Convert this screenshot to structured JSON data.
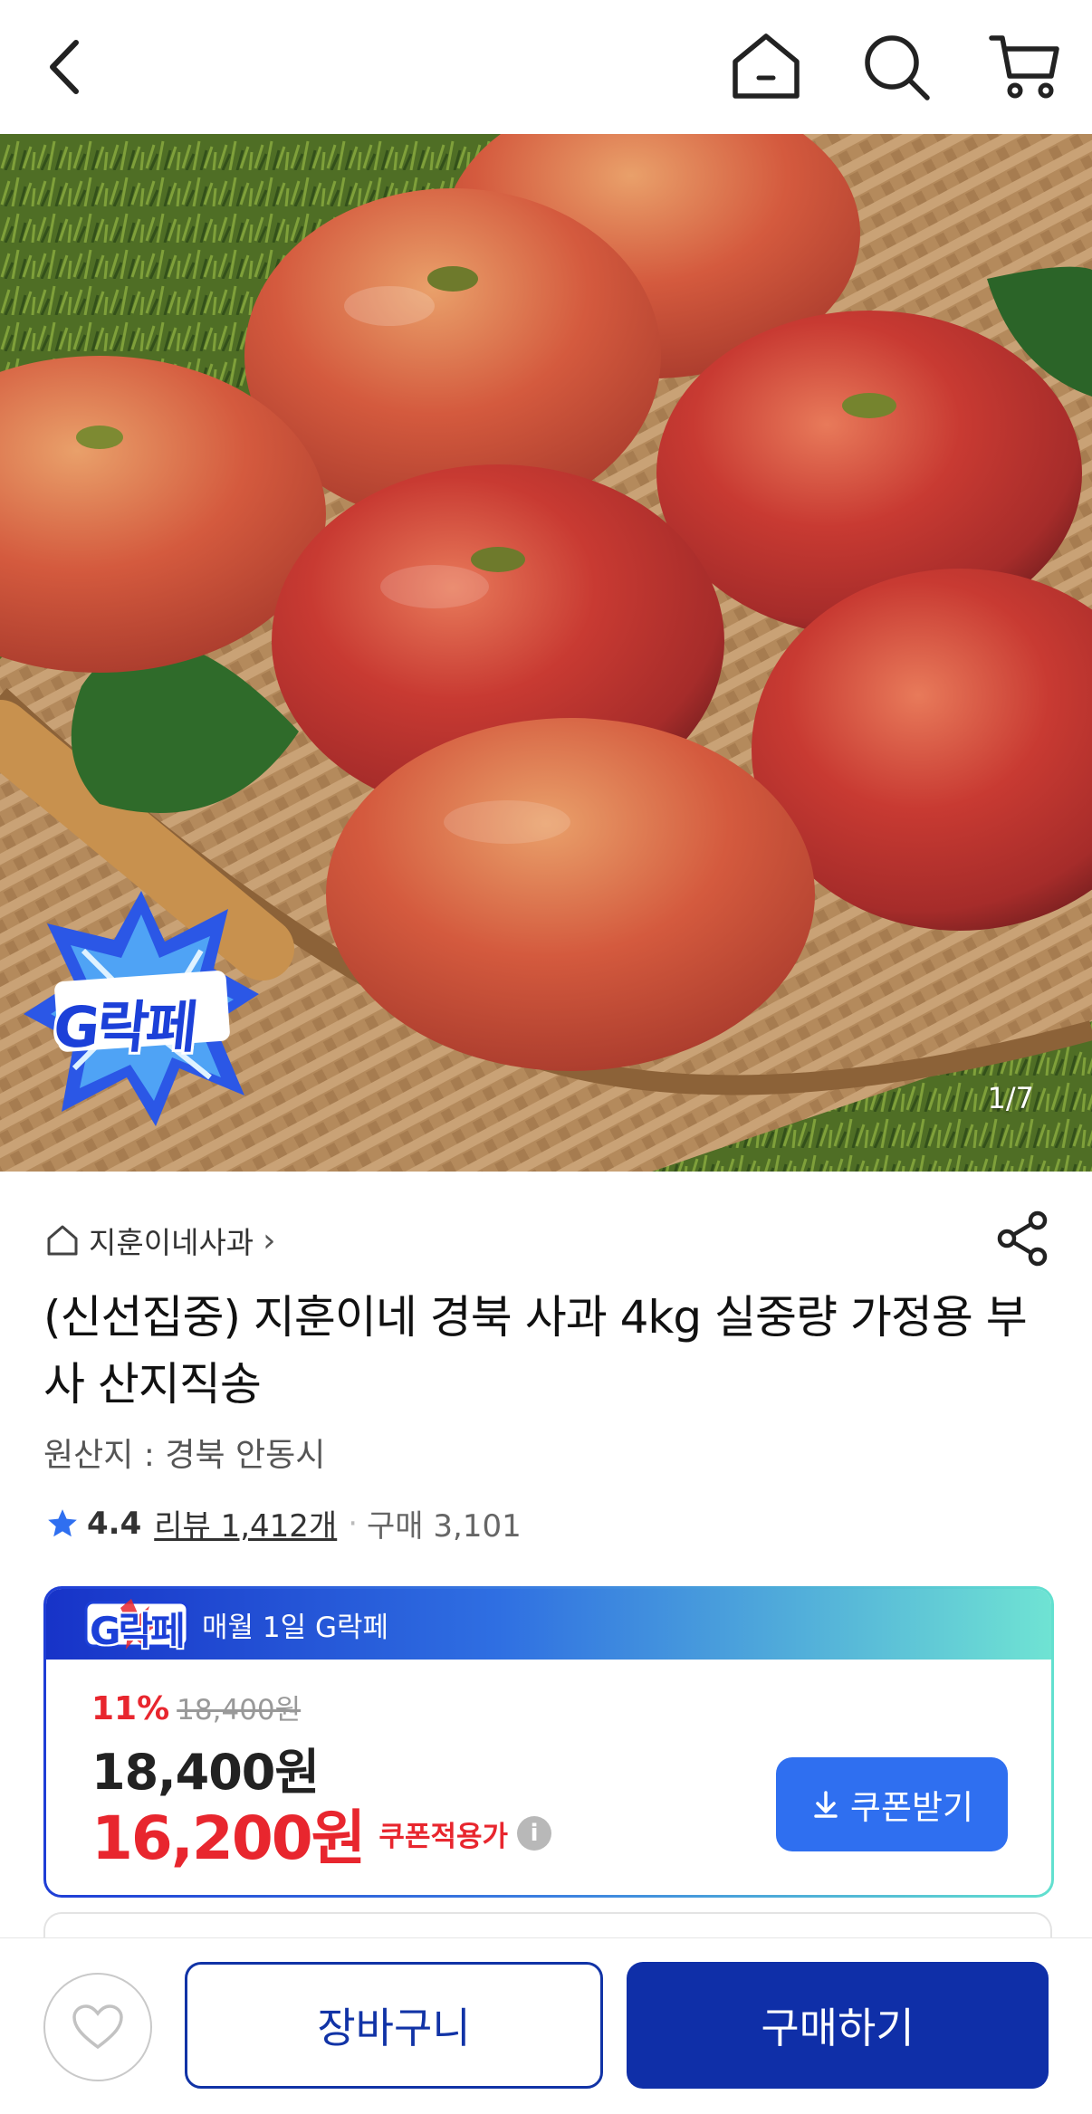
{
  "nav": {
    "back_icon": "chevron-left-icon",
    "home_icon": "home-icon",
    "search_icon": "search-icon",
    "cart_icon": "cart-icon"
  },
  "gallery": {
    "counter": "1/7",
    "badge_text": "G락페"
  },
  "store": {
    "name": "지훈이네사과",
    "chevron": "›"
  },
  "product": {
    "title": "(신선집중) 지훈이네 경북 사과 4kg 실중량 가정용 부사 산지직송",
    "origin": "원산지 : 경북 안동시",
    "rating": "4.4",
    "review": "리뷰 1,412개",
    "dot": "·",
    "purchases": "구매 3,101"
  },
  "price_card": {
    "badge_text": "G락페",
    "event_label": "매월 1일 G락페",
    "discount_pct": "11%",
    "original_price": "18,400원",
    "price": "18,400원",
    "coupon_price": "16,200원",
    "coupon_label": "쿠폰적용가",
    "info_icon": "i",
    "coupon_button": "쿠폰받기"
  },
  "bottom_bar": {
    "cart_button": "장바구니",
    "buy_button": "구매하기"
  },
  "colors": {
    "accent_red": "#e8262e",
    "brand_navy": "#0f2fa8",
    "coupon_blue": "#2f6ff0"
  }
}
